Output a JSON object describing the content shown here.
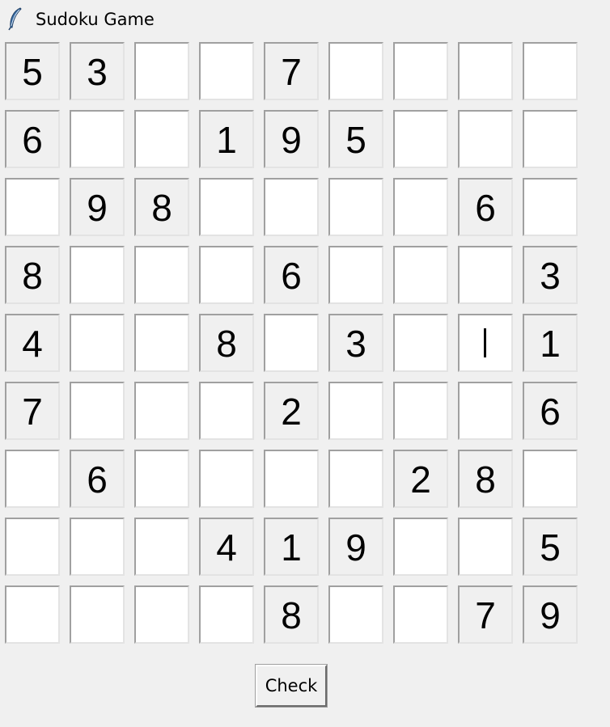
{
  "window": {
    "title": "Sudoku Game",
    "icon": "feather-icon"
  },
  "grid": [
    [
      "5",
      "3",
      "",
      "",
      "7",
      "",
      "",
      "",
      ""
    ],
    [
      "6",
      "",
      "",
      "1",
      "9",
      "5",
      "",
      "",
      ""
    ],
    [
      "",
      "9",
      "8",
      "",
      "",
      "",
      "",
      "6",
      ""
    ],
    [
      "8",
      "",
      "",
      "",
      "6",
      "",
      "",
      "",
      "3"
    ],
    [
      "4",
      "",
      "",
      "8",
      "",
      "3",
      "",
      "",
      "1"
    ],
    [
      "7",
      "",
      "",
      "",
      "2",
      "",
      "",
      "",
      "6"
    ],
    [
      "",
      "6",
      "",
      "",
      "",
      "",
      "2",
      "8",
      ""
    ],
    [
      "",
      "",
      "",
      "4",
      "1",
      "9",
      "",
      "",
      "5"
    ],
    [
      "",
      "",
      "",
      "",
      "8",
      "",
      "",
      "7",
      "9"
    ]
  ],
  "focused_cell": {
    "row": 4,
    "col": 7
  },
  "buttons": {
    "check_label": "Check"
  },
  "colors": {
    "window_bg": "#f0f0f0",
    "empty_cell_bg": "#ffffff",
    "given_cell_bg": "#f0f0f0",
    "text": "#000000"
  }
}
